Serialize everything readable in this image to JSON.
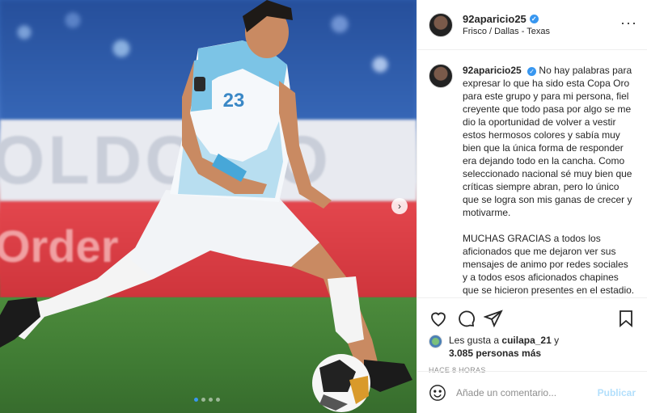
{
  "post": {
    "author": "92aparicio25",
    "location": "Frisco / Dallas - Texas",
    "jersey_number": "23",
    "board_text": "OLDC GO",
    "red_board_text": "Order",
    "caption_paragraphs": [
      "No hay palabras para expresar lo que ha sido esta Copa Oro para este grupo y para mi persona, fiel creyente que todo pasa por algo se me dio la oportunidad de volver a vestir estos hermosos colores y sabía muy bien que la única forma de responder era dejando todo en la cancha. Como seleccionado nacional sé muy bien que críticas siempre abran, pero lo único que se logra son mis ganas de crecer y motivarme.",
      "MUCHAS GRACIAS a todos los aficionados que me dejaron ver sus mensajes de animo por redes sociales y a todos esos aficionados chapines que se hicieron presentes en el estadio."
    ],
    "likes": {
      "prefix": "Les gusta a",
      "user": "cuilapa_21",
      "connector": "y",
      "count_text": "3.085 personas más"
    },
    "timestamp": "HACE 8 HORAS",
    "comment": {
      "placeholder": "Añade un comentario...",
      "submit_label": "Publicar"
    },
    "carousel": {
      "total": 4,
      "active": 1
    }
  },
  "icons": {
    "like": "heart-icon",
    "comment": "comment-icon",
    "share": "share-icon",
    "save": "bookmark-icon",
    "emoji": "smile-icon",
    "more": "more-icon",
    "verified": "verified-icon",
    "next": "chevron-right-icon"
  },
  "colors": {
    "verified": "#3897f0",
    "post_button": "#b2dffc",
    "muted_text": "#8e8e8e"
  }
}
